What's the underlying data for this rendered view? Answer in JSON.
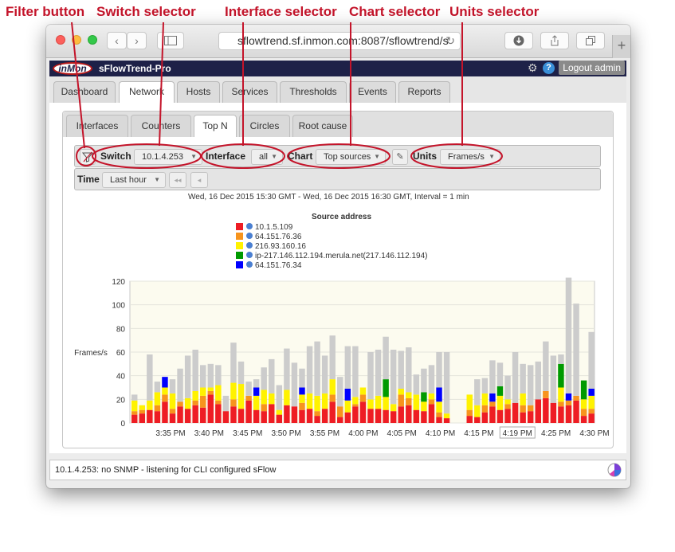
{
  "annotations": {
    "filter_button": "Filter button",
    "switch_selector": "Switch selector",
    "interface_selector": "Interface selector",
    "chart_selector": "Chart selector",
    "units_selector": "Units selector"
  },
  "browser": {
    "url": "sflowtrend.sf.inmon.com:8087/sflowtrend/s",
    "back_icon": "chevron-left-icon",
    "forward_icon": "chevron-right-icon",
    "sidebar_icon": "sidebar-icon",
    "reload_icon": "reload-icon",
    "download_icon": "download-icon",
    "share_icon": "share-icon",
    "tabs_icon": "tabs-icon",
    "new_tab_icon": "plus-icon",
    "new_tab_label": "+"
  },
  "app": {
    "logo": "inMon",
    "title": "sFlowTrend-Pro",
    "logout_label": "Logout admin"
  },
  "main_tabs": [
    "Dashboard",
    "Network",
    "Hosts",
    "Services",
    "Thresholds",
    "Events",
    "Reports"
  ],
  "sub_tabs": [
    "Interfaces",
    "Counters",
    "Top N",
    "Circles",
    "Root cause"
  ],
  "controls": {
    "switch_label": "Switch",
    "switch_value": "10.1.4.253",
    "interface_label": "Interface",
    "interface_value": "all",
    "chart_label": "Chart",
    "chart_value": "Top sources",
    "units_label": "Units",
    "units_value": "Frames/s",
    "time_label": "Time",
    "time_value": "Last hour",
    "rewind_label": "◂◂",
    "back_label": "◂"
  },
  "time_range": "Wed, 16 Dec 2015 15:30 GMT - Wed, 16 Dec 2015 16:30 GMT, Interval = 1 min",
  "status": {
    "text": "10.1.4.253: no SNMP - listening for CLI configured sFlow"
  },
  "colors": {
    "accent_red": "#c4142a",
    "header_bg": "#1e2148"
  },
  "chart_data": {
    "type": "bar",
    "stacked": true,
    "title": "Source address",
    "ylabel": "Frames/s",
    "ylim": [
      0,
      120
    ],
    "yticks": [
      0,
      20,
      40,
      60,
      80,
      100,
      120
    ],
    "xtick_labels": [
      "3:35 PM",
      "3:40 PM",
      "3:45 PM",
      "3:50 PM",
      "3:55 PM",
      "4:00 PM",
      "4:05 PM",
      "4:10 PM",
      "4:15 PM",
      "4:19 PM",
      "4:25 PM",
      "4:30 PM"
    ],
    "highlighted_xtick": "4:19 PM",
    "series": [
      {
        "name": "10.1.5.109",
        "color": "#ee1d24",
        "values": [
          7,
          8,
          11,
          10,
          18,
          8,
          14,
          12,
          15,
          13,
          24,
          16,
          10,
          14,
          12,
          19,
          11,
          10,
          16,
          7,
          15,
          14,
          11,
          12,
          6,
          12,
          18,
          5,
          9,
          14,
          18,
          12,
          12,
          11,
          10,
          14,
          15,
          11,
          10,
          16,
          5,
          4,
          0,
          0,
          6,
          5,
          9,
          14,
          11,
          12,
          17,
          9,
          10,
          20,
          21,
          17,
          14,
          15,
          19,
          6,
          8
        ]
      },
      {
        "name": "64.151.76.36",
        "color": "#f7941d",
        "values": [
          3,
          3,
          0,
          5,
          6,
          4,
          4,
          0,
          4,
          10,
          3,
          3,
          0,
          6,
          0,
          4,
          0,
          6,
          0,
          0,
          0,
          0,
          6,
          0,
          4,
          0,
          6,
          9,
          0,
          2,
          6,
          0,
          0,
          0,
          0,
          10,
          6,
          0,
          0,
          4,
          4,
          0,
          0,
          0,
          5,
          0,
          6,
          4,
          0,
          4,
          0,
          6,
          5,
          0,
          6,
          0,
          4,
          4,
          4,
          6,
          4
        ]
      },
      {
        "name": "216.93.160.16",
        "color": "#fff200",
        "values": [
          9,
          4,
          8,
          11,
          6,
          13,
          0,
          9,
          8,
          7,
          3,
          13,
          0,
          14,
          21,
          0,
          12,
          12,
          9,
          4,
          13,
          0,
          7,
          13,
          13,
          13,
          13,
          0,
          10,
          6,
          6,
          8,
          11,
          11,
          6,
          5,
          5,
          13,
          8,
          5,
          9,
          4,
          0,
          0,
          13,
          10,
          10,
          0,
          12,
          4,
          0,
          10,
          0,
          0,
          0,
          0,
          12,
          0,
          0,
          8,
          11
        ]
      },
      {
        "name": "ip-217.146.112.194.merula.net(217.146.112.194)",
        "color": "#009a00",
        "values": [
          0,
          0,
          0,
          0,
          0,
          0,
          0,
          0,
          0,
          0,
          0,
          0,
          0,
          0,
          0,
          0,
          0,
          0,
          0,
          0,
          0,
          0,
          0,
          0,
          0,
          0,
          0,
          0,
          0,
          0,
          0,
          0,
          0,
          15,
          0,
          0,
          0,
          0,
          8,
          0,
          0,
          0,
          0,
          0,
          0,
          0,
          0,
          0,
          8,
          0,
          0,
          0,
          0,
          0,
          0,
          0,
          20,
          0,
          0,
          16,
          0
        ]
      },
      {
        "name": "64.151.76.34",
        "color": "#0000ff",
        "values": [
          0,
          0,
          0,
          0,
          9,
          0,
          0,
          0,
          0,
          0,
          0,
          0,
          0,
          0,
          0,
          0,
          7,
          0,
          0,
          0,
          0,
          0,
          6,
          0,
          0,
          0,
          0,
          0,
          10,
          0,
          0,
          0,
          0,
          0,
          0,
          0,
          0,
          0,
          0,
          0,
          12,
          0,
          0,
          0,
          0,
          0,
          0,
          7,
          0,
          0,
          0,
          0,
          0,
          0,
          0,
          0,
          0,
          6,
          0,
          0,
          6
        ]
      },
      {
        "name": "",
        "color": "#cccccc",
        "values": [
          5,
          0,
          39,
          9,
          0,
          12,
          28,
          36,
          35,
          19,
          20,
          17,
          13,
          34,
          19,
          12,
          7,
          19,
          29,
          21,
          35,
          37,
          16,
          40,
          46,
          32,
          37,
          25,
          36,
          43,
          0,
          40,
          39,
          36,
          46,
          32,
          38,
          17,
          20,
          24,
          30,
          52,
          0,
          0,
          0,
          22,
          13,
          28,
          20,
          20,
          43,
          25,
          34,
          32,
          42,
          40,
          8,
          98,
          78,
          0,
          48
        ]
      }
    ]
  }
}
